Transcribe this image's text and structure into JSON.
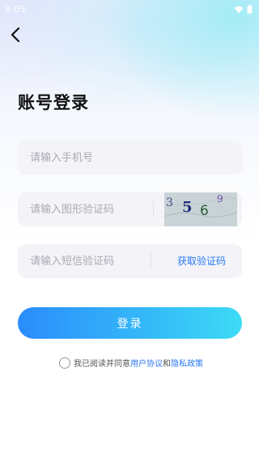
{
  "status_bar": {
    "time": "8:05"
  },
  "page": {
    "title": "账号登录"
  },
  "form": {
    "phone_placeholder": "请输入手机号",
    "captcha_placeholder": "请输入图形验证码",
    "captcha_chars": [
      "3",
      "5",
      "6",
      "9"
    ],
    "sms_placeholder": "请输入短信验证码",
    "get_code_label": "获取验证码"
  },
  "login_button": {
    "label": "登录"
  },
  "agreement": {
    "prefix": "我已阅读并同意",
    "user_agreement": "用户协议",
    "and": "和",
    "privacy_policy": "隐私政策"
  },
  "colors": {
    "accent": "#2a79f2",
    "button_gradient_start": "#2a8cfb",
    "button_gradient_end": "#3ddaf6",
    "field_bg": "#f4f4f8"
  }
}
